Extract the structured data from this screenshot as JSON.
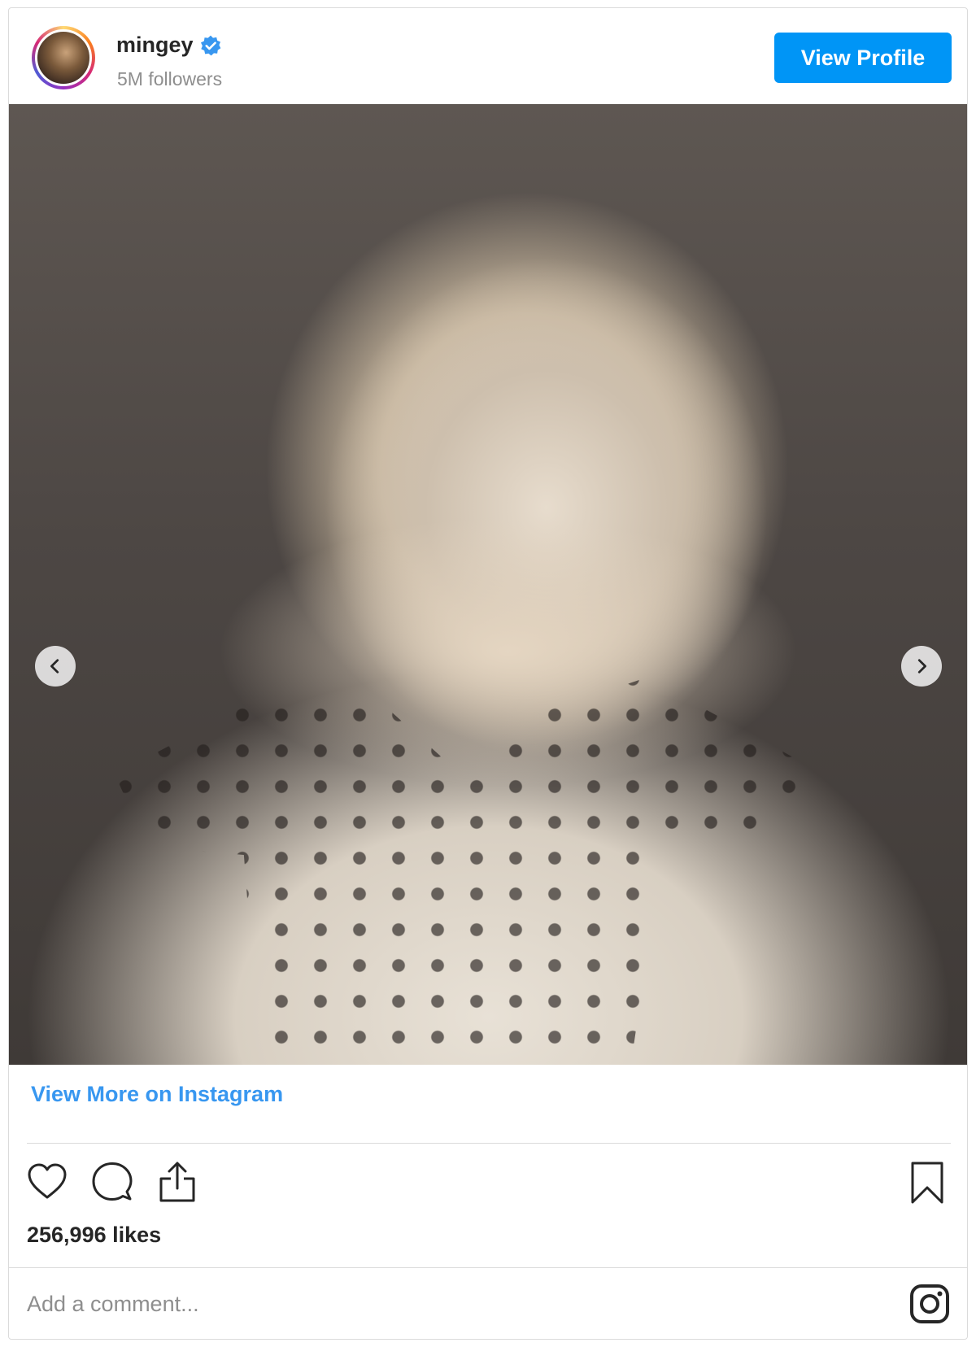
{
  "header": {
    "username": "mingey",
    "verified": true,
    "followers": "5M followers",
    "view_profile_label": "View Profile"
  },
  "photo": {
    "carousel_prev_icon": "chevron-left-icon",
    "carousel_next_icon": "chevron-right-icon",
    "active_slide_indicator": "dot"
  },
  "footer": {
    "view_more_label": "View More on Instagram",
    "actions": [
      "heart-icon",
      "comment-icon",
      "share-icon"
    ],
    "bookmark_icon": "bookmark-icon",
    "likes": "256,996 likes",
    "comment_placeholder": "Add a comment...",
    "logo_icon": "instagram-icon"
  },
  "colors": {
    "accent": "#0095f6",
    "link": "#3897f0",
    "text": "#262626",
    "muted": "#8e8e8e",
    "border": "#dbdbdb"
  }
}
